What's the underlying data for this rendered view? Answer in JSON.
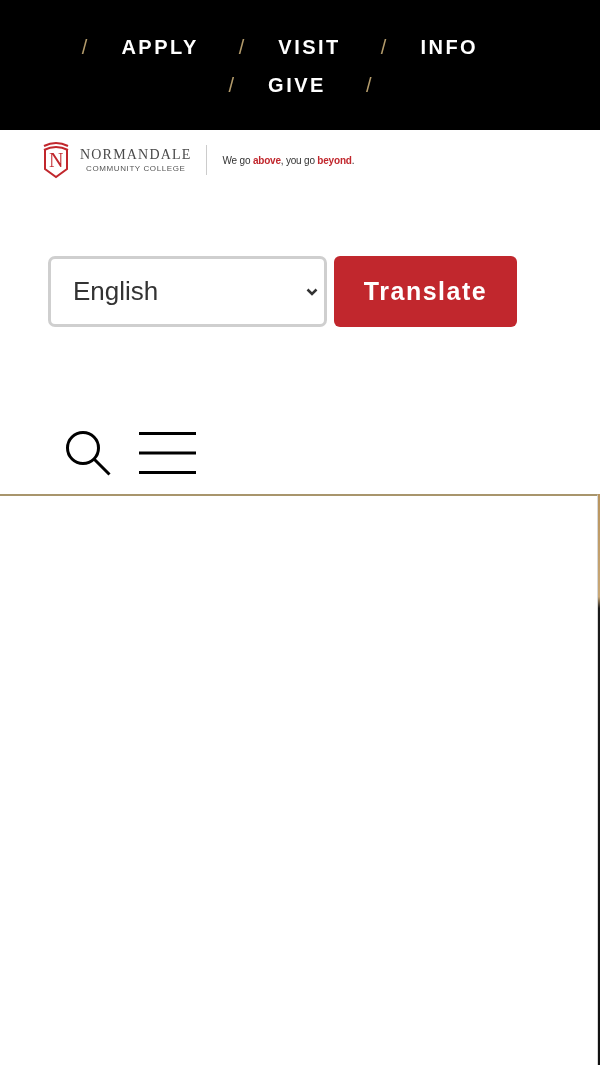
{
  "top_nav": {
    "links": [
      {
        "separator": "/",
        "label": "APPLY"
      },
      {
        "separator": "/",
        "label": "VISIT"
      },
      {
        "separator": "/",
        "label": "INFO"
      },
      {
        "separator": "/",
        "label": "GIVE"
      }
    ],
    "trailing_separator": "/"
  },
  "logo": {
    "mark_letter": "N",
    "name": "NORMANDALE",
    "subtitle": "COMMUNITY COLLEGE",
    "tagline": "We go **above**, you go **beyond**."
  },
  "translate": {
    "language": "English",
    "button": "Translate"
  }
}
